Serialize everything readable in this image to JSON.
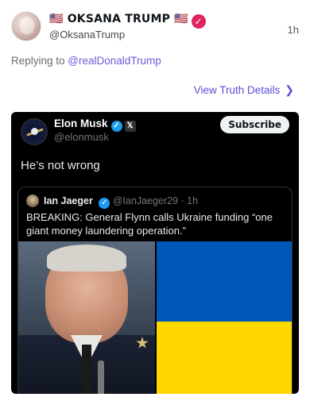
{
  "post": {
    "display_name": "🇺🇸 OKSANA TRUMP 🇺🇸",
    "verified_symbol": "✓",
    "handle": "@OksanaTrump",
    "time": "1h",
    "replying_prefix": "Replying to ",
    "replying_to": "@realDonaldTrump",
    "view_details_label": "View Truth Details",
    "view_details_chevron": "❯"
  },
  "embed": {
    "author_name": "Elon Musk",
    "check_symbol": "✓",
    "x_symbol": "𝕏",
    "author_handle": "@elonmusk",
    "subscribe_label": "Subscribe",
    "text": "He’s not wrong",
    "quote": {
      "author_name": "Ian Jaeger",
      "check_symbol": "✓",
      "author_handle": "@IanJaeger29",
      "time": "· 1h",
      "text": "BREAKING: General Flynn calls Ukraine funding “one giant money laundering operation.”"
    }
  },
  "colors": {
    "accent": "#5b4fd6",
    "verified_pink": "#e0245e",
    "twitter_blue": "#1d9bf0",
    "flag_blue": "#0057b7",
    "flag_yellow": "#ffd700"
  },
  "icons": {
    "avatar": "avatar-photo",
    "verified": "verified-badge-icon",
    "chevron": "chevron-right-icon",
    "x_logo": "x-logo-icon"
  }
}
